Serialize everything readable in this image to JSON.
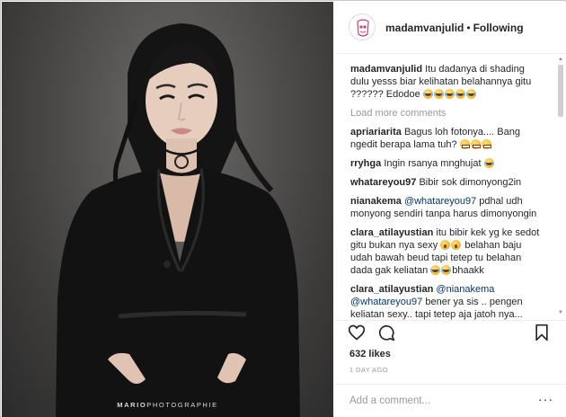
{
  "photo": {
    "alt_subject": "fashion portrait",
    "watermark_bold": "MARIO",
    "watermark_rest": "PHOTOGRAPHIE"
  },
  "header": {
    "username": "madamvanjulid",
    "separator": "•",
    "follow_status": "Following",
    "avatar_icon": "avatar-logo-icon"
  },
  "comments": [
    {
      "user": "madamvanjulid",
      "text": "Itu dadanya di shading dulu yesss biar kelihatan belahannya gitu ?????? Edodoe",
      "emoji": [
        "laugh",
        "laugh",
        "laugh",
        "laugh",
        "laugh"
      ]
    },
    {
      "load_more": "Load more comments"
    },
    {
      "user": "apriariarita",
      "text": "Bagus loh fotonya.... Bang ngedit berapa lama tuh?",
      "emoji": [
        "grin",
        "grin",
        "grin"
      ]
    },
    {
      "user": "rryhga",
      "text": "Ingin rsanya mnghujat",
      "emoji": [
        "laugh"
      ]
    },
    {
      "user": "whatareyou97",
      "text": "Bibir sok dimonyong2in",
      "emoji": []
    },
    {
      "user": "nianakema",
      "mention": "@whatareyou97",
      "text": "pdhal udh monyong sendiri tanpa harus dimonyongin",
      "emoji": []
    },
    {
      "user": "clara_atilayustian",
      "text": "itu bibir kek yg ke sedot gitu bukan nya sexy",
      "emoji": [
        "scream",
        "scream"
      ],
      "text2": "belahan baju udah bawah beud tapi tetep tu belahan dada gak keliatan",
      "emoji2": [
        "laugh",
        "laugh"
      ],
      "text3": "bhaakk"
    },
    {
      "user": "clara_atilayustian",
      "mention": "@nianakema",
      "mention2": "@whatareyou97",
      "text": "bener ya sis .. pengen keliatan sexy.. tapi tetep aja jatoh nya..."
    }
  ],
  "actions": {
    "like_icon": "heart-icon",
    "comment_icon": "comment-bubble-icon",
    "save_icon": "bookmark-icon"
  },
  "likes": "632 likes",
  "date": "1 DAY AGO",
  "add_comment": {
    "placeholder": "Add a comment...",
    "more_label": "···"
  }
}
